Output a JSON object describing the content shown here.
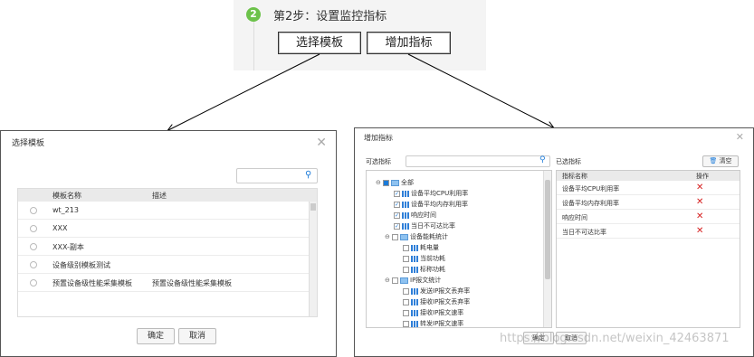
{
  "step": {
    "number": "2",
    "title": "第2步：设置监控指标",
    "buttons": {
      "select_template": "选择模板",
      "add_indicator": "增加指标"
    }
  },
  "left_dialog": {
    "title": "选择模板",
    "search_placeholder": "",
    "columns": [
      "模板名称",
      "描述"
    ],
    "rows": [
      {
        "name": "wt_213",
        "desc": ""
      },
      {
        "name": "XXX",
        "desc": ""
      },
      {
        "name": "XXX-副本",
        "desc": ""
      },
      {
        "name": "设备级别模板测试",
        "desc": ""
      },
      {
        "name": "预置设备级性能采集模板",
        "desc": "预置设备级性能采集模板"
      }
    ],
    "ok": "确定",
    "cancel": "取消"
  },
  "right_dialog": {
    "title": "增加指标",
    "available_label": "可选指标",
    "selected_label": "已选指标",
    "clear_label": "清空",
    "tree": [
      {
        "label": "全部",
        "type": "root",
        "checked": "partial"
      },
      {
        "label": "设备平均CPU利用率",
        "type": "leaf",
        "checked": true
      },
      {
        "label": "设备平均内存利用率",
        "type": "leaf",
        "checked": true
      },
      {
        "label": "响应时间",
        "type": "leaf",
        "checked": true
      },
      {
        "label": "当日不可达比率",
        "type": "leaf",
        "checked": true
      },
      {
        "label": "设备能耗统计",
        "type": "folder",
        "checked": false
      },
      {
        "label": "耗电量",
        "type": "leaf2",
        "checked": false
      },
      {
        "label": "当前功耗",
        "type": "leaf2",
        "checked": false
      },
      {
        "label": "标称功耗",
        "type": "leaf2",
        "checked": false
      },
      {
        "label": "IP报文统计",
        "type": "folder",
        "checked": false
      },
      {
        "label": "发送IP报文丢弃率",
        "type": "leaf2",
        "checked": false
      },
      {
        "label": "接收IP报文丢弃率",
        "type": "leaf2",
        "checked": false
      },
      {
        "label": "接收IP报文速率",
        "type": "leaf2",
        "checked": false
      },
      {
        "label": "转发IP报文速率",
        "type": "leaf2",
        "checked": false
      }
    ],
    "selected_columns": [
      "指标名称",
      "操作"
    ],
    "selected": [
      "设备平均CPU利用率",
      "设备平均内存利用率",
      "响应时间",
      "当日不可达比率"
    ],
    "ok": "确定",
    "cancel": "取消"
  },
  "watermark": "https://blog.csdn.net/weixin_42463871",
  "colors": {
    "accent": "#1a7ad9",
    "step_green": "#6cc24a",
    "delete_red": "#d62020"
  }
}
